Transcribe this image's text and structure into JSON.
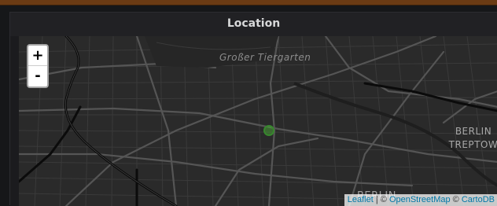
{
  "panel": {
    "title": "Location"
  },
  "map": {
    "zoom_in_label": "+",
    "zoom_out_label": "-",
    "labels": {
      "park": "Großer Tiergarten",
      "district_line1": "BERLIN",
      "district_line2": "TREPTOW",
      "bottom_label": "BERLIN"
    },
    "attribution": {
      "leaflet": "Leaflet",
      "separator1": " | © ",
      "osm": "OpenStreetMap",
      "separator2": " © ",
      "carto": "CartoDB"
    },
    "marker": {
      "color": "#37872d"
    },
    "colors": {
      "background": "#2a2a2a",
      "road": "#4a4a4a",
      "major_road": "#5a5a5a",
      "railway": "#0b0b0b",
      "header_strip": "#6b3b14"
    }
  }
}
